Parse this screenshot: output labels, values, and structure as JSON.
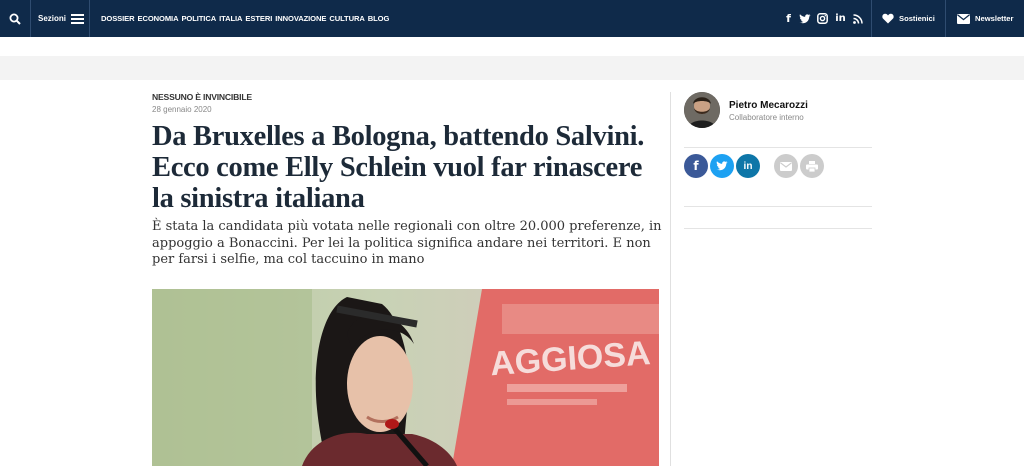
{
  "topbar": {
    "sections_label": "Sezioni",
    "nav_items": [
      "DOSSIER",
      "ECONOMIA",
      "POLITICA",
      "ITALIA",
      "ESTERI",
      "INNOVAZIONE",
      "CULTURA",
      "BLOG"
    ],
    "support_label": "Sostienici",
    "newsletter_label": "Newsletter"
  },
  "article": {
    "kicker": "NESSUNO È INVINCIBILE",
    "date": "28 gennaio 2020",
    "title": "Da Bruxelles a Bologna, battendo Salvini. Ecco come Elly Schlein vuol far rinascere la sinistra italiana",
    "summary": "È stata la candidata più votata nelle regionali con oltre 20.000 preferenze, in appoggio a Bonaccini. Per lei la politica significa andare nei territori. E non per farsi i selfie, ma col taccuino in mano",
    "photo_sign_text": "AGGIOSA"
  },
  "author": {
    "name": "Pietro Mecarozzi",
    "role": "Collaboratore interno"
  },
  "colors": {
    "topbar": "#0f2a4a",
    "facebook": "#3b5998",
    "twitter": "#1da1f2",
    "linkedin": "#0e76a8",
    "share_grey": "#cccccc"
  }
}
